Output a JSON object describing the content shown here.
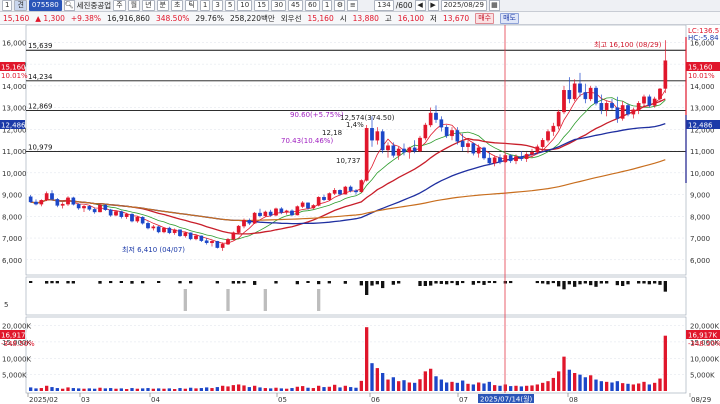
{
  "toolbar": {
    "first_control": "1",
    "tab": "견",
    "stock_code": "075580",
    "search_icon": "search-icon",
    "stock_name": "세진중공업",
    "period_buttons": [
      "주",
      "월",
      "년",
      "분",
      "초",
      "틱"
    ],
    "interval_buttons": [
      "1",
      "3",
      "5",
      "10",
      "15",
      "30",
      "45",
      "60",
      "1"
    ],
    "count": "134",
    "count_total": "/600",
    "date": "2025/08/29"
  },
  "quote": {
    "price": "15,160",
    "change": "1,300",
    "change_pct": "+9.38%",
    "volume": "16,916,860",
    "vol_ratio": "348.50%",
    "turnover": "29.76%",
    "amount": "258,220백만",
    "fgn": "외우선",
    "fgn_val": "15,160",
    "open_label": "시",
    "open": "13,880",
    "high_label": "고",
    "high": "16,100",
    "low_label": "저",
    "low": "13,670",
    "buy_label": "매수",
    "sell_label": "매도"
  },
  "price_panel": {
    "y_ticks": [
      "16,000",
      "15,000",
      "14,000",
      "13,000",
      "12,000",
      "11,000",
      "10,000",
      "9,000",
      "8,000",
      "7,000",
      "6,000"
    ],
    "h_lines": [
      {
        "label": "15,639",
        "value": 15639
      },
      {
        "label": "14,234",
        "value": 14234
      },
      {
        "label": "12,869",
        "value": 12869
      },
      {
        "label": "10,979",
        "value": 10979
      }
    ],
    "current_price_tag": "15,160",
    "current_pct_tag": "10.01%",
    "left_price_tag": "12,486",
    "right_price_tag": "12,486",
    "lc_label": "LC:136.51",
    "hc_label": "HC:-5.84",
    "annotations": [
      {
        "text": "최고 16,100 (08/29)",
        "color": "#d0182c"
      },
      {
        "text": "최저 6,410 (04/07)",
        "color": "#1c3aa8"
      },
      {
        "text": "90.60(+5.75%)",
        "color": "#a020c0"
      },
      {
        "text": "12,574(374.50)",
        "color": "#202020"
      },
      {
        "text": "70.43(10.46%)",
        "color": "#a020c0"
      },
      {
        "text": "12,18",
        "color": "#202020"
      },
      {
        "text": "10,737",
        "color": "#202020"
      },
      {
        "text": "1,4%",
        "color": "#202020"
      }
    ]
  },
  "indicator_panel": {
    "left_label": "5"
  },
  "volume_panel": {
    "y_ticks": [
      "20,000K",
      "15,000K",
      "10,000K",
      "5,000K"
    ],
    "volume_tag": "16,917K",
    "ratio_tag": "-348.50%"
  },
  "x_axis": {
    "labels": [
      "2025/02",
      "03",
      "04",
      "05",
      "06",
      "07",
      "08",
      "08/29"
    ],
    "cursor_date": "2025/07/14(월)"
  },
  "chart_data": {
    "type": "candlestick",
    "y_range": [
      5300,
      16800
    ],
    "candles": [
      [
        8900,
        8980,
        8620,
        8660
      ],
      [
        8660,
        8780,
        8500,
        8560
      ],
      [
        8560,
        8780,
        8460,
        8740
      ],
      [
        8740,
        9140,
        8700,
        9050
      ],
      [
        9050,
        9200,
        8720,
        8780
      ],
      [
        8780,
        8840,
        8420,
        8500
      ],
      [
        8500,
        8650,
        8360,
        8560
      ],
      [
        8560,
        8920,
        8480,
        8850
      ],
      [
        8850,
        8900,
        8500,
        8550
      ],
      [
        8550,
        8600,
        8300,
        8380
      ],
      [
        8380,
        8520,
        8200,
        8460
      ],
      [
        8460,
        8500,
        8250,
        8320
      ],
      [
        8320,
        8400,
        8120,
        8200
      ],
      [
        8200,
        8580,
        8180,
        8520
      ],
      [
        8520,
        8560,
        8250,
        8300
      ],
      [
        8300,
        8340,
        7980,
        8050
      ],
      [
        8050,
        8280,
        8000,
        8220
      ],
      [
        8220,
        8260,
        7900,
        7980
      ],
      [
        7980,
        8160,
        7880,
        8100
      ],
      [
        8100,
        8140,
        7720,
        7780
      ],
      [
        7780,
        8020,
        7700,
        7960
      ],
      [
        7960,
        8000,
        7620,
        7680
      ],
      [
        7680,
        7780,
        7400,
        7460
      ],
      [
        7460,
        7600,
        7350,
        7520
      ],
      [
        7520,
        7560,
        7220,
        7280
      ],
      [
        7280,
        7500,
        7220,
        7460
      ],
      [
        7460,
        7520,
        7180,
        7240
      ],
      [
        7240,
        7440,
        7150,
        7380
      ],
      [
        7380,
        7400,
        7050,
        7100
      ],
      [
        7100,
        7300,
        7020,
        7240
      ],
      [
        7240,
        7260,
        6900,
        6960
      ],
      [
        6960,
        7150,
        6900,
        7100
      ],
      [
        7100,
        7120,
        6820,
        6880
      ],
      [
        6880,
        7000,
        6700,
        6780
      ],
      [
        6780,
        6900,
        6610,
        6850
      ],
      [
        6850,
        6870,
        6520,
        6560
      ],
      [
        6560,
        6800,
        6410,
        6720
      ],
      [
        6720,
        7000,
        6680,
        6940
      ],
      [
        6940,
        7300,
        6900,
        7250
      ],
      [
        7250,
        7600,
        7200,
        7550
      ],
      [
        7550,
        7900,
        7450,
        7820
      ],
      [
        7820,
        7900,
        7600,
        7680
      ],
      [
        7680,
        8200,
        7650,
        8150
      ],
      [
        8150,
        8350,
        7950,
        8020
      ],
      [
        8020,
        8260,
        7980,
        8200
      ],
      [
        8200,
        8300,
        7980,
        8050
      ],
      [
        8050,
        8400,
        8000,
        8350
      ],
      [
        8350,
        8420,
        8100,
        8180
      ],
      [
        8180,
        8300,
        8080,
        8250
      ],
      [
        8250,
        8320,
        8000,
        8060
      ],
      [
        8060,
        8500,
        8040,
        8450
      ],
      [
        8450,
        8700,
        8380,
        8620
      ],
      [
        8620,
        8640,
        8300,
        8380
      ],
      [
        8380,
        8560,
        8320,
        8500
      ],
      [
        8500,
        8920,
        8460,
        8880
      ],
      [
        8880,
        9000,
        8700,
        8760
      ],
      [
        8760,
        9100,
        8720,
        9050
      ],
      [
        9050,
        9300,
        8980,
        9200
      ],
      [
        9200,
        9240,
        8950,
        9020
      ],
      [
        9020,
        9400,
        9000,
        9350
      ],
      [
        9350,
        9420,
        9100,
        9180
      ],
      [
        9180,
        9250,
        9000,
        9120
      ],
      [
        9120,
        9700,
        9100,
        9650
      ],
      [
        9650,
        12200,
        9600,
        12050
      ],
      [
        12050,
        12600,
        11200,
        11500
      ],
      [
        11500,
        12100,
        11300,
        11900
      ],
      [
        11900,
        12000,
        10900,
        11050
      ],
      [
        11050,
        11400,
        10700,
        11250
      ],
      [
        11250,
        11400,
        10700,
        10800
      ],
      [
        10800,
        11200,
        10600,
        11100
      ],
      [
        11100,
        11350,
        10800,
        10950
      ],
      [
        10950,
        11200,
        10650,
        11150
      ],
      [
        11150,
        11500,
        10900,
        11000
      ],
      [
        11000,
        11700,
        10950,
        11600
      ],
      [
        11600,
        12300,
        11500,
        12200
      ],
      [
        12200,
        13000,
        12100,
        12750
      ],
      [
        12750,
        13100,
        12300,
        12450
      ],
      [
        12450,
        12600,
        11900,
        12100
      ],
      [
        12100,
        12200,
        11600,
        11700
      ],
      [
        11700,
        12100,
        11500,
        11950
      ],
      [
        11950,
        12100,
        11300,
        11450
      ],
      [
        11450,
        11800,
        11000,
        11200
      ],
      [
        11200,
        11500,
        10900,
        11350
      ],
      [
        11350,
        11400,
        10800,
        10900
      ],
      [
        10900,
        11300,
        10700,
        11150
      ],
      [
        11150,
        11200,
        10600,
        10680
      ],
      [
        10680,
        10950,
        10350,
        10450
      ],
      [
        10450,
        10800,
        10300,
        10700
      ],
      [
        10700,
        10850,
        10400,
        10500
      ],
      [
        10500,
        10900,
        10450,
        10800
      ],
      [
        10800,
        10850,
        10450,
        10550
      ],
      [
        10550,
        10850,
        10400,
        10750
      ],
      [
        10750,
        11000,
        10550,
        10650
      ],
      [
        10650,
        10950,
        10500,
        10850
      ],
      [
        10850,
        11100,
        10700,
        10950
      ],
      [
        10950,
        11300,
        10850,
        11200
      ],
      [
        11200,
        11600,
        11100,
        11500
      ],
      [
        11500,
        12000,
        11400,
        11900
      ],
      [
        11900,
        12300,
        11700,
        12150
      ],
      [
        12150,
        12900,
        12000,
        12800
      ],
      [
        12800,
        14000,
        12700,
        13800
      ],
      [
        13800,
        14400,
        13200,
        13400
      ],
      [
        13400,
        14300,
        13300,
        14100
      ],
      [
        14100,
        14600,
        13500,
        13700
      ],
      [
        13700,
        14100,
        13200,
        13400
      ],
      [
        13400,
        14000,
        13300,
        13900
      ],
      [
        13900,
        14000,
        13100,
        13200
      ],
      [
        13200,
        13600,
        12700,
        12900
      ],
      [
        12900,
        13300,
        12600,
        13200
      ],
      [
        13200,
        13400,
        12900,
        13000
      ],
      [
        13000,
        13500,
        12300,
        12500
      ],
      [
        12500,
        13300,
        12400,
        13100
      ],
      [
        13100,
        13200,
        12600,
        12700
      ],
      [
        12700,
        13000,
        12500,
        12900
      ],
      [
        12900,
        13300,
        12700,
        13200
      ],
      [
        13200,
        13600,
        13000,
        13500
      ],
      [
        13500,
        13600,
        13000,
        13100
      ],
      [
        13100,
        13500,
        13000,
        13400
      ],
      [
        13400,
        13900,
        13300,
        13860
      ],
      [
        13880,
        16100,
        13670,
        15160
      ]
    ],
    "volumes": [
      1.1,
      0.8,
      0.9,
      1.6,
      1.2,
      0.9,
      0.7,
      1.1,
      0.9,
      0.8,
      0.7,
      0.8,
      0.7,
      1.0,
      0.8,
      0.9,
      0.7,
      0.8,
      0.6,
      0.9,
      0.7,
      0.8,
      0.9,
      0.7,
      0.8,
      0.7,
      0.8,
      0.6,
      0.9,
      0.7,
      1.0,
      0.8,
      0.9,
      1.1,
      0.9,
      1.2,
      1.6,
      1.4,
      1.8,
      2.0,
      1.7,
      1.2,
      1.6,
      1.1,
      0.9,
      0.8,
      1.0,
      0.8,
      0.7,
      0.9,
      1.3,
      1.5,
      1.0,
      0.9,
      1.6,
      1.2,
      1.3,
      1.9,
      1.1,
      1.6,
      1.2,
      1.0,
      3.1,
      19.5,
      8.5,
      7.0,
      5.5,
      3.5,
      4.2,
      3.0,
      3.3,
      2.6,
      2.5,
      3.6,
      6.0,
      6.8,
      4.5,
      3.5,
      2.6,
      2.8,
      2.5,
      3.2,
      2.2,
      2.0,
      2.6,
      2.3,
      2.8,
      1.8,
      1.6,
      2.0,
      1.5,
      1.6,
      1.4,
      1.6,
      1.7,
      2.0,
      2.5,
      3.0,
      4.0,
      6.0,
      10.5,
      6.5,
      5.5,
      5.0,
      4.2,
      4.8,
      3.5,
      3.0,
      2.8,
      2.6,
      3.0,
      2.4,
      2.2,
      2.0,
      2.3,
      2.8,
      2.0,
      2.5,
      3.8,
      16.9
    ],
    "volume_range_k": [
      0,
      22000
    ],
    "ma_colors": {
      "ma5": "#e01b2d",
      "ma10": "#2d9c2d",
      "ma20": "#c81e2a",
      "ma60": "#1f2fa0",
      "ma120": "#c86e1e"
    }
  }
}
